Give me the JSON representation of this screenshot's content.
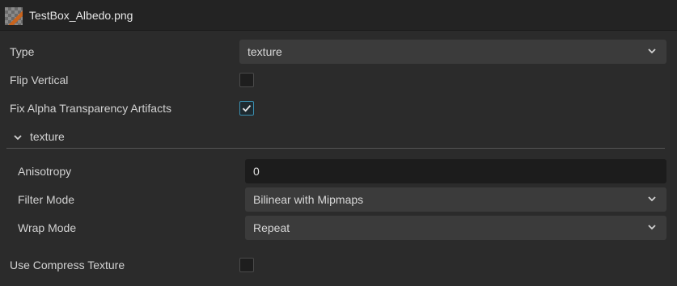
{
  "header": {
    "title": "TestBox_Albedo.png",
    "thumbnail_icon": "image-thumbnail-icon"
  },
  "props": {
    "type": {
      "label": "Type",
      "value": "texture"
    },
    "flip_vertical": {
      "label": "Flip Vertical",
      "checked": false
    },
    "fix_alpha": {
      "label": "Fix Alpha Transparency Artifacts",
      "checked": true
    },
    "use_compress": {
      "label": "Use Compress Texture",
      "checked": false
    }
  },
  "section": {
    "title": "texture",
    "expanded": true,
    "anisotropy": {
      "label": "Anisotropy",
      "value": "0"
    },
    "filter_mode": {
      "label": "Filter Mode",
      "value": "Bilinear with Mipmaps"
    },
    "wrap_mode": {
      "label": "Wrap Mode",
      "value": "Repeat"
    }
  },
  "colors": {
    "accent": "#3a8fb0",
    "background": "#2b2b2b",
    "header": "#232323"
  }
}
